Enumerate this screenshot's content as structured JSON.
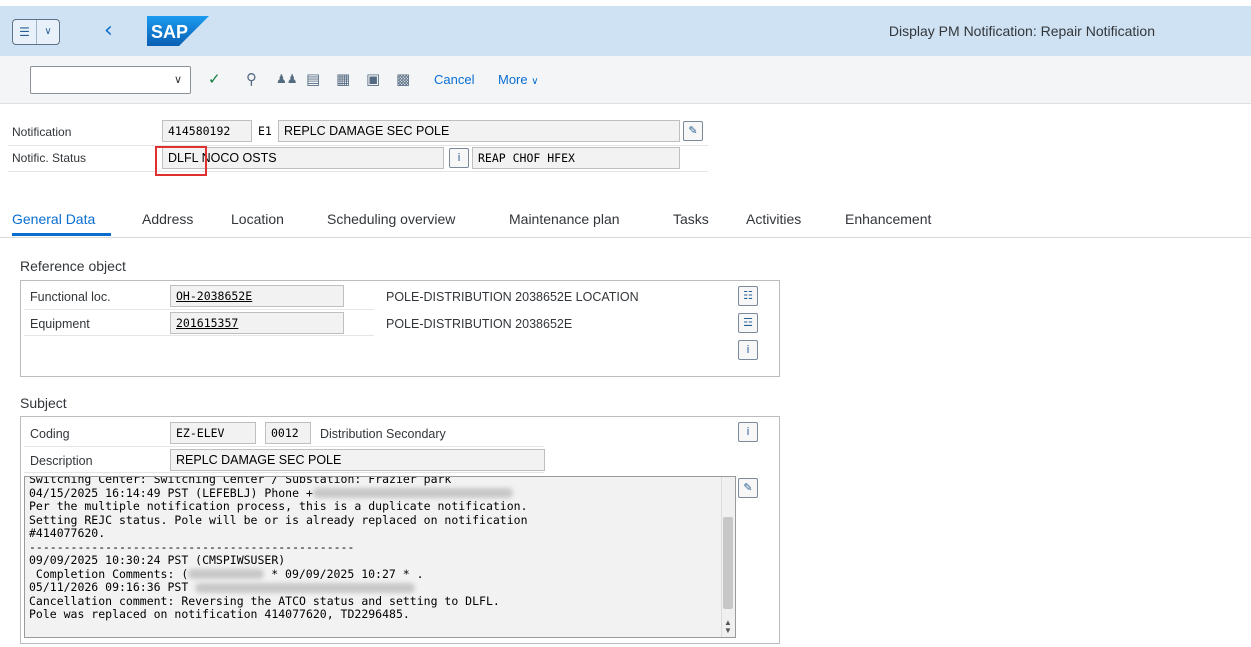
{
  "shell": {
    "menu_icon": "menu-icon",
    "back_icon": "back-arrow-icon",
    "logo_text": "SAP",
    "title": "Display PM Notification: Repair Notification"
  },
  "toolbar": {
    "command_value": "",
    "cancel_label": "Cancel",
    "more_label": "More"
  },
  "header": {
    "notification_label": "Notification",
    "notification_number": "414580192",
    "notification_type": "E1",
    "notification_text": "REPLC DAMAGE SEC POLE",
    "status_label": "Notific. Status",
    "system_status": "DLFL NOCO OSTS",
    "user_status": "REAP CHOF HFEX"
  },
  "tabs": [
    {
      "label": "General Data",
      "active": true
    },
    {
      "label": "Address"
    },
    {
      "label": "Location"
    },
    {
      "label": "Scheduling overview"
    },
    {
      "label": "Maintenance plan"
    },
    {
      "label": "Tasks"
    },
    {
      "label": "Activities"
    },
    {
      "label": "Enhancement"
    }
  ],
  "reference_object": {
    "title": "Reference object",
    "functional_loc_label": "Functional loc.",
    "functional_loc_value": "OH-2038652E",
    "functional_loc_desc": "POLE-DISTRIBUTION 2038652E LOCATION",
    "equipment_label": "Equipment",
    "equipment_value": "201615357",
    "equipment_desc": "POLE-DISTRIBUTION 2038652E"
  },
  "subject": {
    "title": "Subject",
    "coding_label": "Coding",
    "coding_group": "EZ-ELEV",
    "coding_code": "0012",
    "coding_desc": "Distribution Secondary",
    "description_label": "Description",
    "description_value": "REPLC DAMAGE SEC POLE",
    "long_text_lines": [
      "Switching Center: Switching Center / Substation: Frazier park",
      "04/15/2025 16:14:49 PST (LEFEBLJ) Phone +",
      "Per the multiple notification process, this is a duplicate notification.",
      "Setting REJC status. Pole will be or is already replaced on notification",
      "#414077620.",
      "-----------------------------------------------",
      "09/09/2025 10:30:24 PST (CMSPIWSUSER)",
      " Completion Comments: (",
      "05/11/2026 09:16:36 PST",
      "Cancellation comment: Reversing the ATCO status and setting to DLFL.",
      "Pole was replaced on notification 414077620, TD2296485."
    ],
    "completion_suffix": "* 09/09/2025 10:27 * ."
  },
  "colors": {
    "accent": "#0a6ed1",
    "shell_bg": "#cfe2f3",
    "highlight_box": "#e03030"
  }
}
